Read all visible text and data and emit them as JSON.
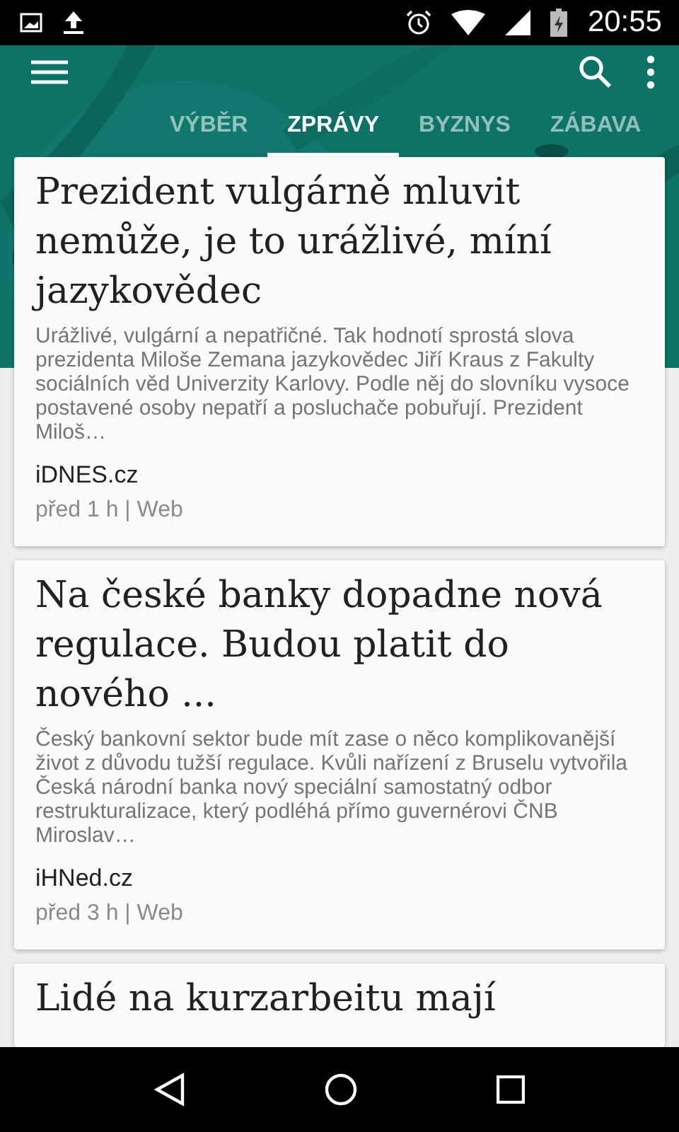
{
  "status_bar": {
    "time": "20:55"
  },
  "tabs": [
    {
      "label": "VÝBĚR",
      "selected": false
    },
    {
      "label": "ZPRÁVY",
      "selected": true
    },
    {
      "label": "BYZNYS",
      "selected": false
    },
    {
      "label": "ZÁBAVA",
      "selected": false
    }
  ],
  "articles": [
    {
      "title": "Prezident vulgárně mluvit nemůže, je to urážlivé, míní jazykovědec",
      "snippet": "Urážlivé, vulgární a nepatřičné. Tak hodnotí sprostá slova prezidenta Miloše Zemana jazykovědec Jiří Kraus z Fakulty sociálních věd Univerzity Karlovy. Podle něj do slovníku vysoce postavené osoby nepatří a posluchače pobuřují. Prezident Miloš…",
      "source": "iDNES.cz",
      "meta": "před 1 h | Web"
    },
    {
      "title": "Na české banky dopadne nová regulace. Budou platit do nového ...",
      "snippet": "Český bankovní sektor bude mít zase o něco komplikovanější život z důvodu tužší regulace. Kvůli nařízení z Bruselu vytvořila Česká národní banka nový speciální samostatný odbor restrukturalizace, který podléhá přímo guvernérovi ČNB Miroslav…",
      "source": "iHNed.cz",
      "meta": "před 3 h | Web"
    },
    {
      "title": "Lidé na kurzarbeitu mají"
    }
  ]
}
